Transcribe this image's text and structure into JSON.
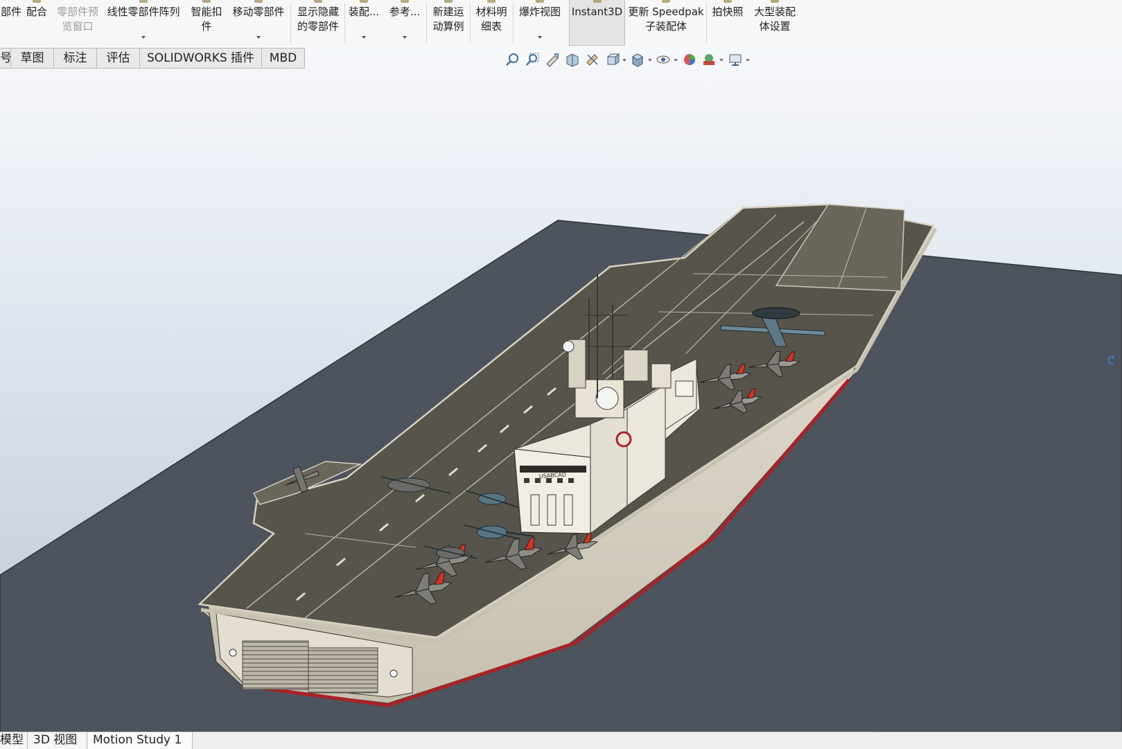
{
  "ribbon": {
    "buttons": [
      {
        "l1": "部件",
        "l2": ""
      },
      {
        "l1": "配合",
        "l2": ""
      },
      {
        "l1": "零部件预",
        "l2": "览窗口"
      },
      {
        "l1": "线性零部件阵列",
        "l2": ""
      },
      {
        "l1": "智能扣",
        "l2": "件"
      },
      {
        "l1": "移动零部件",
        "l2": ""
      },
      {
        "l1": "显示隐藏",
        "l2": "的零部件"
      },
      {
        "l1": "装配...",
        "l2": ""
      },
      {
        "l1": "参考...",
        "l2": ""
      },
      {
        "l1": "新建运",
        "l2": "动算例"
      },
      {
        "l1": "材料明",
        "l2": "细表"
      },
      {
        "l1": "爆炸视图",
        "l2": ""
      },
      {
        "l1": "Instant3D",
        "l2": ""
      },
      {
        "l1": "更新 Speedpak",
        "l2": "子装配体"
      },
      {
        "l1": "拍快照",
        "l2": ""
      },
      {
        "l1": "大型装配",
        "l2": "体设置"
      }
    ]
  },
  "tabs": [
    "号",
    "草图",
    "标注",
    "评估",
    "SOLIDWORKS 插件",
    "MBD"
  ],
  "view_toolbar": {
    "icons": [
      "zoom-to-fit-icon",
      "zoom-to-area-icon",
      "previous-view-icon",
      "section-view-icon",
      "dynamic-annotation-icon",
      "view-orientation-icon",
      "display-style-icon",
      "hide-show-items-icon",
      "edit-appearance-icon",
      "apply-scene-icon",
      "view-settings-icon"
    ]
  },
  "model": {
    "island_label": "USABCAD",
    "colors": {
      "deck": "#57544b",
      "hull": "#ddd7ca",
      "boot_stripe": "#a82226",
      "ground_plane": "#4d545e",
      "island": "#ece7dc",
      "tail_fin": "#d3331f"
    }
  },
  "bottom_tabs": [
    "模型",
    "3D 视图",
    "Motion Study 1"
  ]
}
